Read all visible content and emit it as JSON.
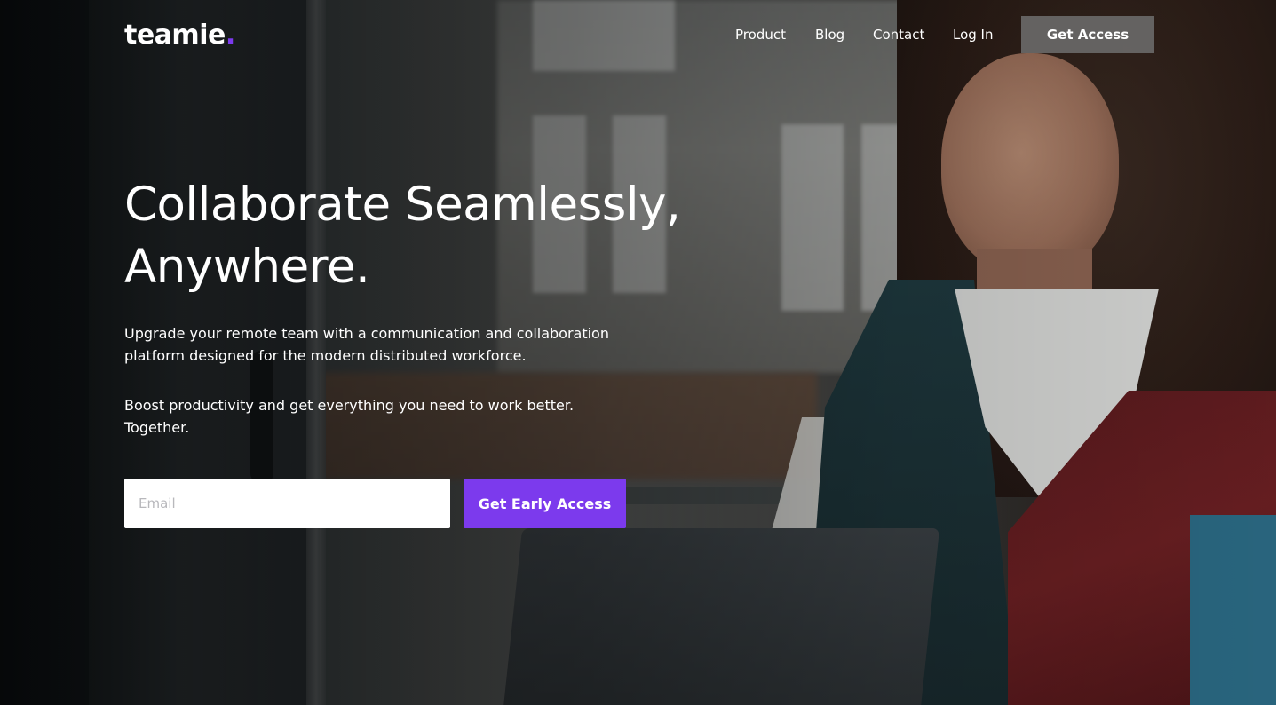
{
  "brand": {
    "name": "teamie",
    "dot": ".",
    "accent_color": "#7c3aed"
  },
  "nav": {
    "links": [
      "Product",
      "Blog",
      "Contact",
      "Log In"
    ],
    "cta_label": "Get Access"
  },
  "hero": {
    "headline_line1": "Collaborate Seamlessly,",
    "headline_line2": "Anywhere.",
    "paragraph1_line1": "Upgrade your remote team with a communication and collaboration",
    "paragraph1_line2": "platform designed for the modern distributed workforce.",
    "paragraph2_line1": "Boost productivity and get everything you need to work better.",
    "paragraph2_line2": "Together."
  },
  "signup": {
    "email_placeholder": "Email",
    "email_value": "",
    "button_label": "Get Early Access"
  }
}
